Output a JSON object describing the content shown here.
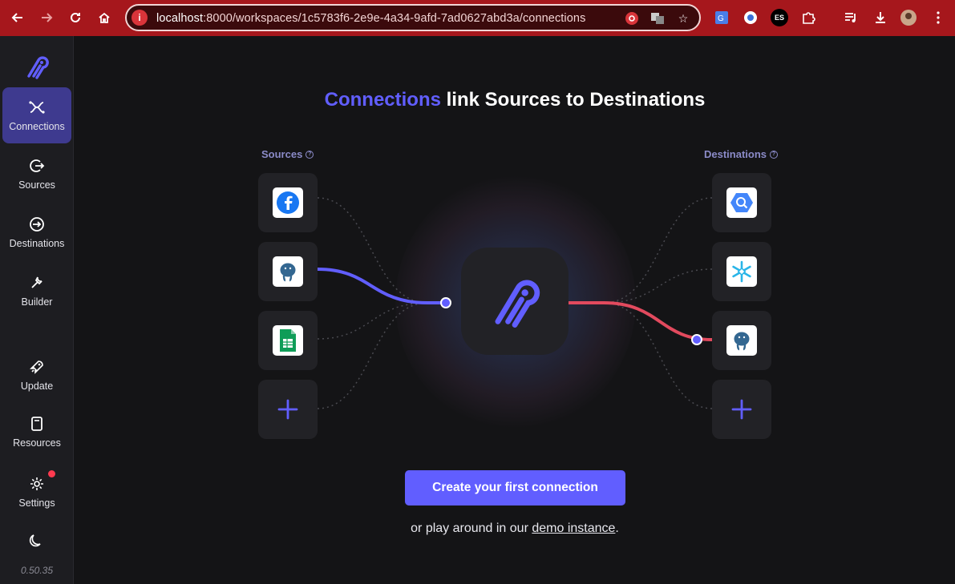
{
  "browser": {
    "url_host": "localhost",
    "url_rest": ":8000/workspaces/1c5783f6-2e9e-4a34-9afd-7ad0627abd3a/connections",
    "profile_badge": "ES"
  },
  "sidebar": {
    "items": [
      {
        "label": "Connections",
        "icon": "connections-icon",
        "active": true
      },
      {
        "label": "Sources",
        "icon": "sources-icon"
      },
      {
        "label": "Destinations",
        "icon": "destinations-icon"
      },
      {
        "label": "Builder",
        "icon": "builder-icon"
      },
      {
        "label": "Update",
        "icon": "rocket-icon"
      },
      {
        "label": "Resources",
        "icon": "book-icon"
      },
      {
        "label": "Settings",
        "icon": "gear-icon"
      }
    ],
    "theme_icon": "moon-icon",
    "version": "0.50.35"
  },
  "main": {
    "headline_accent": "Connections",
    "headline_rest": " link Sources to Destinations",
    "sources_label": "Sources",
    "destinations_label": "Destinations",
    "sources": [
      "facebook-icon",
      "postgres-icon",
      "google-sheets-icon",
      "add-source-icon"
    ],
    "destinations": [
      "bigquery-icon",
      "snowflake-icon",
      "postgres-icon",
      "add-destination-icon"
    ],
    "cta_label": "Create your first connection",
    "demo_prefix": "or play around in our ",
    "demo_link": "demo instance",
    "demo_suffix": "."
  },
  "colors": {
    "accent": "#615eff",
    "active_nav": "#3e3a8f",
    "destination_flow": "#e24a5e",
    "browser_frame": "#a6171c"
  }
}
